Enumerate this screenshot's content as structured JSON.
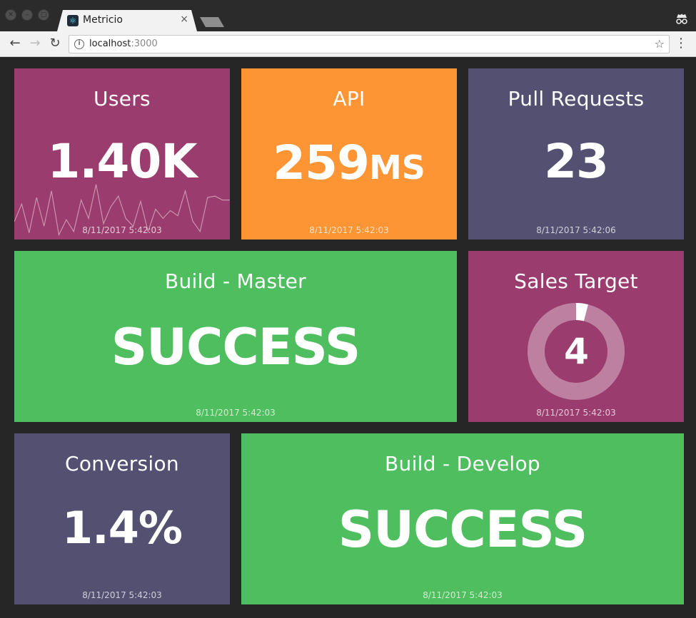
{
  "browser": {
    "tab_title": "Metricio",
    "tab_close": "×",
    "url_host": "localhost",
    "url_port": ":3000"
  },
  "colors": {
    "purple": "#9b3c6e",
    "orange": "#fd9535",
    "slate": "#535072",
    "green": "#4fbe5f",
    "background": "#262626"
  },
  "tiles": {
    "users": {
      "title": "Users",
      "value": "1.40K",
      "timestamp": "8/11/2017 5:42:03",
      "sparkline": [
        0.25,
        0.52,
        0.08,
        0.62,
        0.18,
        0.72,
        0.05,
        0.28,
        0.1,
        0.58,
        0.3,
        0.82,
        0.22,
        0.48,
        0.64,
        0.3,
        0.18,
        0.56,
        0.1,
        0.44,
        0.3,
        0.42,
        0.34,
        0.72,
        0.26,
        0.1,
        0.62,
        0.64,
        0.58,
        0.58
      ]
    },
    "api": {
      "title": "API",
      "value": "259",
      "unit": "MS",
      "timestamp": "8/11/2017 5:42:03"
    },
    "pull_requests": {
      "title": "Pull Requests",
      "value": "23",
      "timestamp": "8/11/2017 5:42:06"
    },
    "build_master": {
      "title": "Build - Master",
      "value": "SUCCESS",
      "timestamp": "8/11/2017 5:42:03"
    },
    "sales_target": {
      "title": "Sales Target",
      "value": "4",
      "progress_fraction": 0.04,
      "timestamp": "8/11/2017 5:42:03"
    },
    "conversion": {
      "title": "Conversion",
      "value": "1.4%",
      "timestamp": "8/11/2017 5:42:03"
    },
    "build_develop": {
      "title": "Build - Develop",
      "value": "SUCCESS",
      "timestamp": "8/11/2017 5:42:03"
    }
  }
}
